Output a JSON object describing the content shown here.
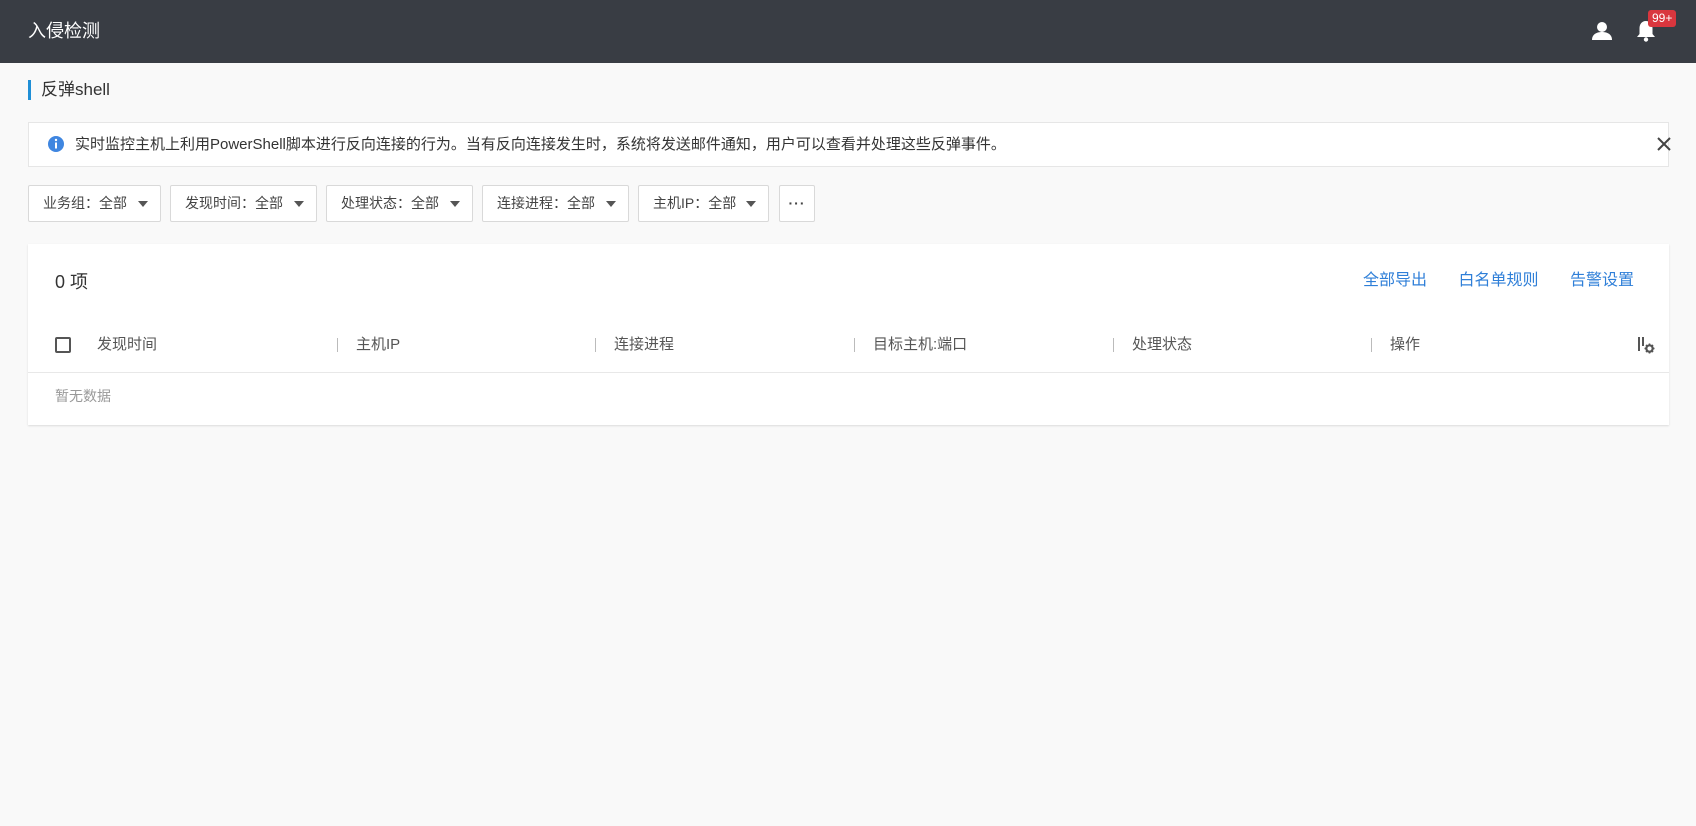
{
  "header": {
    "title": "入侵检测",
    "notification_badge": "99+"
  },
  "page": {
    "title": "反弹shell"
  },
  "notice": {
    "text": "实时监控主机上利用PowerShell脚本进行反向连接的行为。当有反向连接发生时，系统将发送邮件通知，用户可以查看并处理这些反弹事件。"
  },
  "filters": [
    {
      "label": "业务组：全部"
    },
    {
      "label": "发现时间：全部"
    },
    {
      "label": "处理状态：全部"
    },
    {
      "label": "连接进程：全部"
    },
    {
      "label": "主机IP：全部"
    }
  ],
  "more_label": "···",
  "table": {
    "count_label": "0 项",
    "actions": [
      "全部导出",
      "白名单规则",
      "告警设置"
    ],
    "columns": [
      "发现时间",
      "主机IP",
      "连接进程",
      "目标主机:端口",
      "处理状态",
      "操作"
    ],
    "empty_text": "暂无数据"
  },
  "colors": {
    "topbar": "#393d44",
    "accent": "#1f8fd6",
    "link": "#2f7fd8",
    "badge": "#d9363e"
  }
}
